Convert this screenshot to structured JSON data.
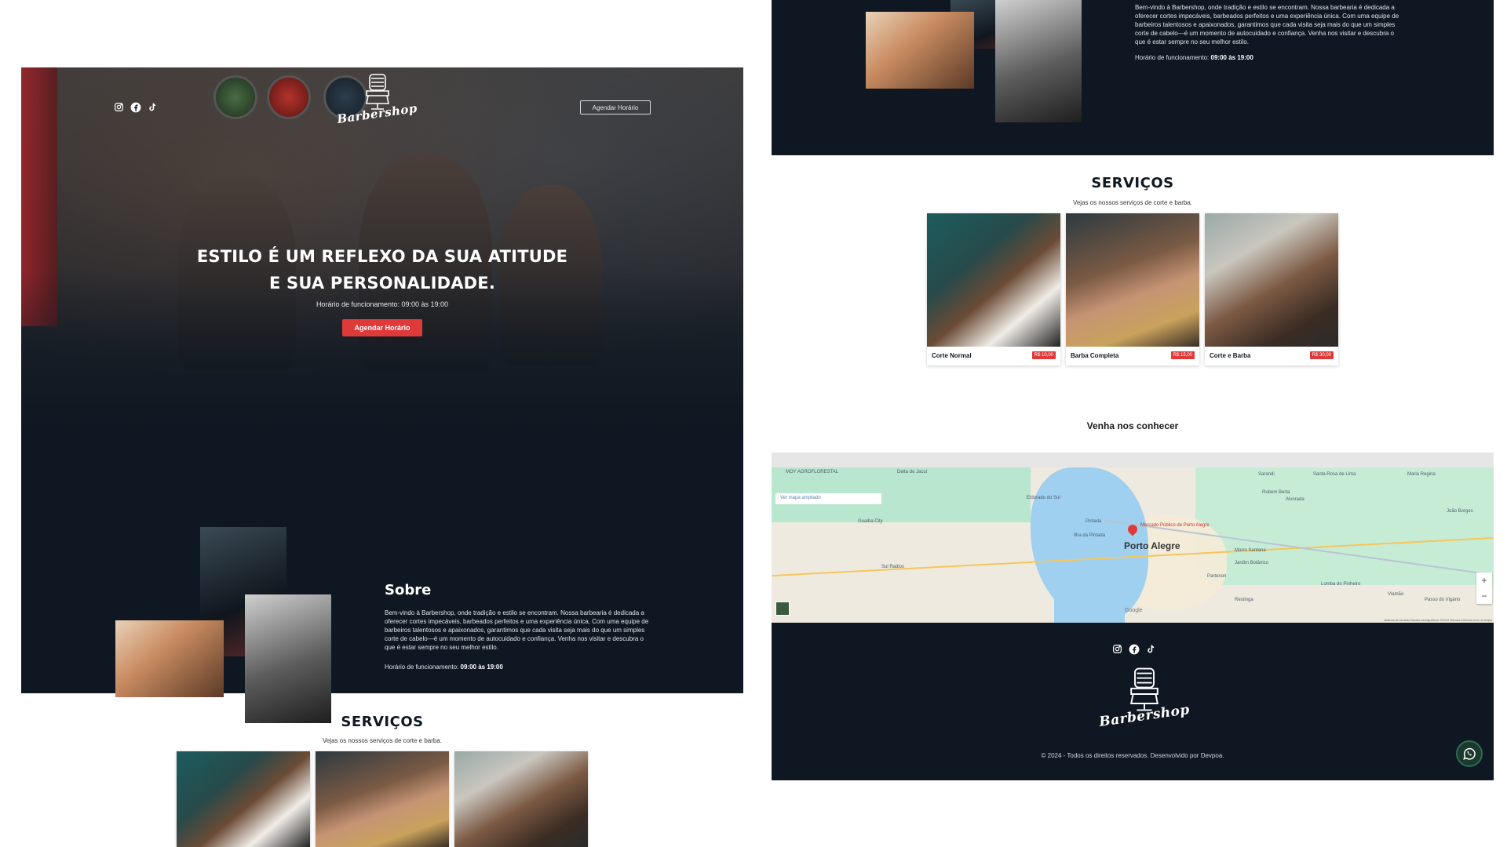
{
  "header": {
    "brand": "Barbershop",
    "cta_label": "Agendar Horário",
    "social_icons": [
      "instagram-icon",
      "facebook-icon",
      "tiktok-icon"
    ]
  },
  "hero": {
    "title": "ESTILO É UM REFLEXO DA SUA ATITUDE\nE SUA PERSONALIDADE.",
    "hours": "Horário de funcionamento: 09:00 às 19:00",
    "button_label": "Agendar Horário"
  },
  "about": {
    "title": "Sobre",
    "text": "Bem-vindo à Barbershop, onde tradição e estilo se encontram. Nossa barbearia é dedicada a oferecer cortes impecáveis, barbeados perfeitos e uma experiência única. Com uma equipe de barbeiros talentosos e apaixonados, garantimos que cada visita seja mais do que um simples corte de cabelo—é um momento de autocuidado e confiança. Venha nos visitar e descubra o que é estar sempre no seu melhor estilo.",
    "hours_label": "Horário de funcionamento:",
    "hours_value": "09:00 às 19:00"
  },
  "services": {
    "title": "SERVIÇOS",
    "subtitle": "Vejas os nossos serviços de corte e barba.",
    "items": [
      {
        "name": "Corte Normal",
        "price": "R$ 10,00"
      },
      {
        "name": "Barba Completa",
        "price": "R$ 15,00"
      },
      {
        "name": "Corte e Barba",
        "price": "R$ 30,00"
      }
    ]
  },
  "location": {
    "title": "Venha nos conhecer",
    "map_search_placeholder": "Ver mapa ampliado",
    "city_label": "Porto Alegre",
    "pin_label": "Mercado Público de Porto Alegre",
    "labels": [
      "MOY AGROFLORESTAL",
      "Delta do Jacuí",
      "Guaíba City",
      "Eldorado do Sul",
      "Pintada",
      "Ilha da Pintada",
      "Sul Radios",
      "Sarandi",
      "Santa Rosa de Lima",
      "Rubem Berta",
      "Alvorada",
      "Maria Regina",
      "Jardim Botânico",
      "Partenon",
      "Morro Santana",
      "Restinga",
      "Lomba do Pinheiro",
      "Viamão",
      "Passo do Vigário",
      "João Borges"
    ],
    "zoom_in": "+",
    "zoom_out": "−",
    "google": "Google",
    "terms": "Atalhos do teclado  Dados cartográficos ©2024  Termos  Informar erro no mapa"
  },
  "footer": {
    "brand": "Barbershop",
    "copyright": "© 2024 - Todos os direitos reservados. Desenvolvido por Devpoa."
  },
  "colors": {
    "dark": "#0f1822",
    "accent_red": "#e0393a",
    "white": "#ffffff"
  }
}
